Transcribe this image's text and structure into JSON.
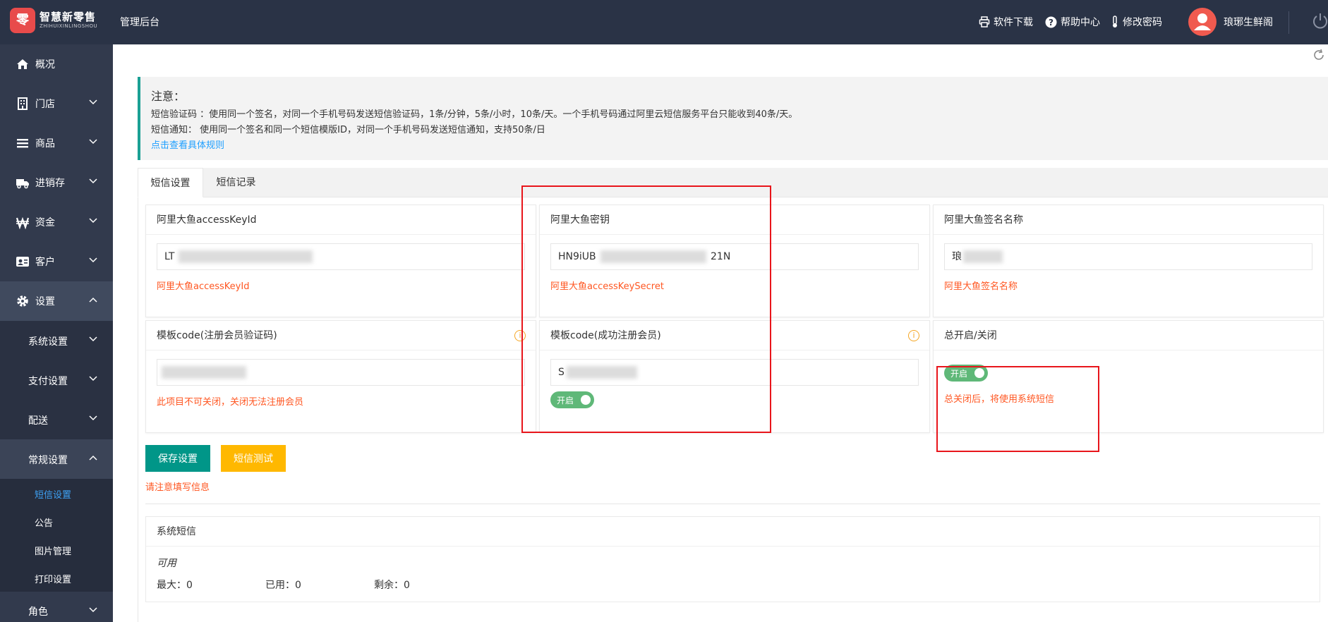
{
  "brand": {
    "logo_char": "零",
    "name": "智慧新零售",
    "sub": "ZHIHUIXINLINGSHOU",
    "accent": "#e84b4b"
  },
  "header": {
    "title": "管理后台",
    "links": [
      {
        "label": "软件下载",
        "icon": "printer-icon"
      },
      {
        "label": "帮助中心",
        "icon": "help-circle-icon"
      },
      {
        "label": "修改密码",
        "icon": "thermometer-icon"
      }
    ],
    "user": "琅琊生鲜阁",
    "bg": "#2a3346"
  },
  "sidebar": {
    "items": [
      {
        "label": "概况",
        "icon": "home-icon"
      },
      {
        "label": "门店",
        "icon": "building-icon"
      },
      {
        "label": "商品",
        "icon": "list-icon"
      },
      {
        "label": "进销存",
        "icon": "truck-icon"
      },
      {
        "label": "资金",
        "icon": "won-icon"
      },
      {
        "label": "客户",
        "icon": "id-card-icon"
      },
      {
        "label": "设置",
        "icon": "gear-icon"
      }
    ],
    "sub_items": [
      "系统设置",
      "支付设置",
      "配送",
      "常规设置"
    ],
    "leaves": [
      "短信设置",
      "公告",
      "图片管理",
      "打印设置"
    ],
    "bottom_item": "角色"
  },
  "notice": {
    "title": "注意：",
    "line1": "短信验证码 ：使用同一个签名，对同一个手机号码发送短信验证码，1条/分钟，5条/小时，10条/天。一个手机号码通过阿里云短信服务平台只能收到40条/天。",
    "line2": "短信通知： 使用同一个签名和同一个短信模版ID，对同一个手机号码发送短信通知，支持50条/日",
    "link": "点击查看具体规则"
  },
  "tabs": [
    "短信设置",
    "短信记录"
  ],
  "fields": {
    "access_key_id": {
      "label": "阿里大鱼accessKeyId",
      "value_start": "LT",
      "hint": "阿里大鱼accessKeyId"
    },
    "access_key_secret": {
      "label": "阿里大鱼密钥",
      "value_start": "HN9iUB",
      "value_end": "21N",
      "hint": "阿里大鱼accessKeySecret"
    },
    "sign_name": {
      "label": "阿里大鱼签名名称",
      "value_start": "琅",
      "hint": "阿里大鱼签名名称"
    },
    "tpl_register_code": {
      "label": "模板code(注册会员验证码)",
      "hint": "此项目不可关闭，关闭无法注册会员"
    },
    "tpl_register_success": {
      "label": "模板code(成功注册会员)",
      "value_start": "S",
      "switch": "开启"
    },
    "master_switch": {
      "label": "总开启/关闭",
      "switch": "开启",
      "hint": "总关闭后，将使用系统短信"
    }
  },
  "buttons": {
    "save": "保存设置",
    "test": "短信测试"
  },
  "form_note": "请注意填写信息",
  "system_sms": {
    "title": "系统短信",
    "status": "可用",
    "max": "最大：0",
    "used": "已用：0",
    "left": "剩余：0"
  }
}
